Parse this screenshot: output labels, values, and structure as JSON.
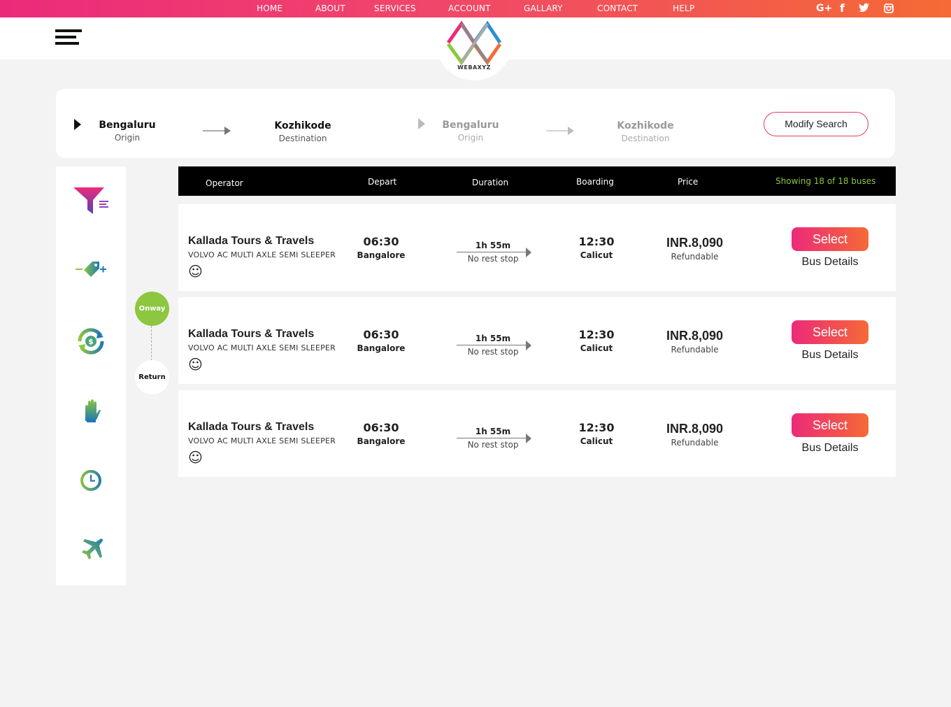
{
  "nav": {
    "items": [
      "HOME",
      "ABOUT",
      "SERVICES",
      "ACCOUNT",
      "GALLARY",
      "CONTACT",
      "HELP"
    ],
    "social": [
      "google-plus",
      "facebook",
      "twitter",
      "instagram"
    ],
    "social_glyphs": [
      "G+",
      "f",
      "t",
      "◎"
    ]
  },
  "logo": {
    "text": "WEBAXYZ"
  },
  "route": {
    "onward_origin": {
      "city": "Bengaluru",
      "label": "Origin"
    },
    "onward_destination": {
      "city": "Kozhikode",
      "label": "Destination"
    },
    "return_origin": {
      "city": "Bengaluru",
      "label": "Origin"
    },
    "return_destination": {
      "city": "Kozhikode",
      "label": "Destination"
    },
    "modify_label": "Modify Search"
  },
  "sidebar": {
    "icons": [
      "filter-icon",
      "price-tag-icon",
      "refund-icon",
      "hand-icon",
      "clock-icon",
      "airplane-icon"
    ]
  },
  "trip": {
    "onway": "Onway",
    "return": "Return"
  },
  "table": {
    "headers": {
      "operator": "Operator",
      "depart": "Depart",
      "duration": "Duration",
      "boarding": "Boarding",
      "price": "Price"
    },
    "showing": "Showing 18 of 18 buses"
  },
  "buses": [
    {
      "operator": "Kallada Tours & Travels",
      "type": "VOLVO AC MULTI AXLE SEMI SLEEPER",
      "depart_time": "06:30",
      "depart_place": "Bangalore",
      "duration": "1h 55m",
      "stops": "No rest stop",
      "board_time": "12:30",
      "board_place": "Calicut",
      "price": "INR.8,090",
      "refund": "Refundable",
      "select": "Select",
      "details": "Bus Details",
      "smiley": "☺"
    },
    {
      "operator": "Kallada Tours & Travels",
      "type": "VOLVO AC MULTI AXLE SEMI SLEEPER",
      "depart_time": "06:30",
      "depart_place": "Bangalore",
      "duration": "1h 55m",
      "stops": "No rest stop",
      "board_time": "12:30",
      "board_place": "Calicut",
      "price": "INR.8,090",
      "refund": "Refundable",
      "select": "Select",
      "details": "Bus Details",
      "smiley": "☺"
    },
    {
      "operator": "Kallada Tours & Travels",
      "type": "VOLVO AC MULTI AXLE SEMI SLEEPER",
      "depart_time": "06:30",
      "depart_place": "Bangalore",
      "duration": "1h 55m",
      "stops": "No rest stop",
      "board_time": "12:30",
      "board_place": "Calicut",
      "price": "INR.8,090",
      "refund": "Refundable",
      "select": "Select",
      "details": "Bus Details",
      "smiley": "☺"
    }
  ],
  "colors": {
    "accent_pink": "#ec2a7a",
    "accent_orange": "#f56a35",
    "green": "#8dc63f"
  }
}
